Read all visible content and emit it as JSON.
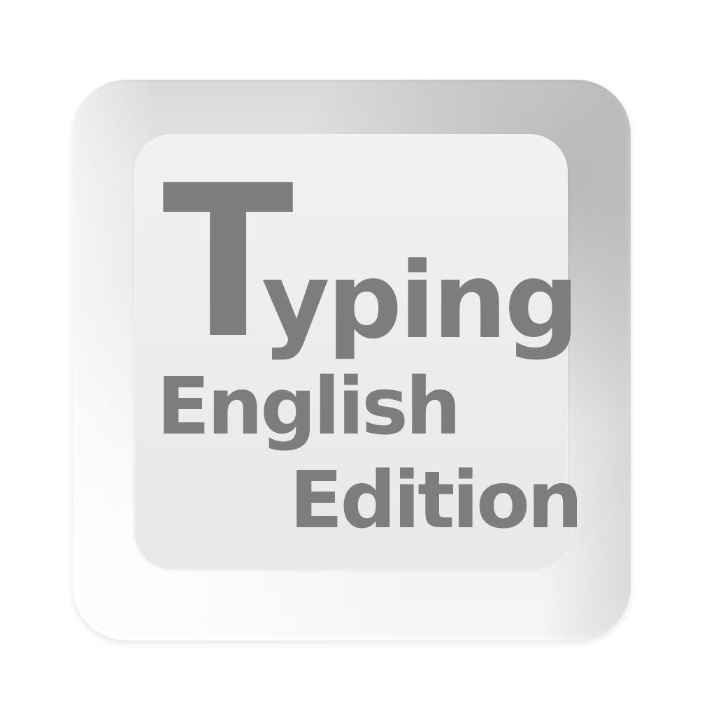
{
  "icon": {
    "name": "keyboard-key-icon",
    "title_first_letter": "T",
    "title_rest": "yping",
    "subtitle_line1": "English",
    "subtitle_line2": "Edition",
    "colors": {
      "text": "#7d7d7d",
      "key_face": "#eeeeef",
      "key_body": "#e4e4e4",
      "background": "#ffffff"
    }
  }
}
